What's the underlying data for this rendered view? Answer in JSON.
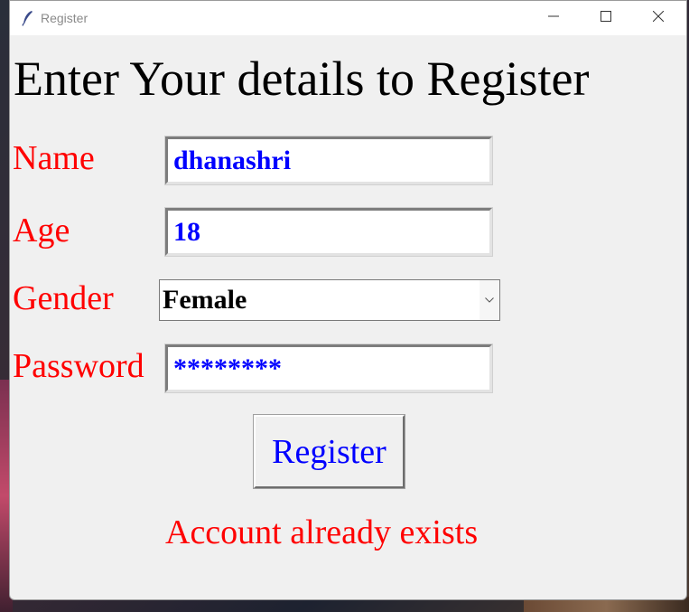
{
  "window": {
    "title": "Register",
    "controls": {
      "minimize_icon": "minimize-icon",
      "maximize_icon": "maximize-icon",
      "close_icon": "close-icon"
    }
  },
  "form": {
    "heading": "Enter Your details to Register",
    "fields": {
      "name": {
        "label": "Name",
        "value": "dhanashri"
      },
      "age": {
        "label": "Age",
        "value": "18"
      },
      "gender": {
        "label": "Gender",
        "selected": "Female"
      },
      "password": {
        "label": "Password",
        "value": "********"
      }
    },
    "submit_label": "Register",
    "status_message": "Account already exists"
  },
  "colors": {
    "label": "#ff0000",
    "entry_text": "#0000ff",
    "button_text": "#0000ff",
    "status": "#ff0000",
    "window_bg": "#f0f0f0"
  }
}
